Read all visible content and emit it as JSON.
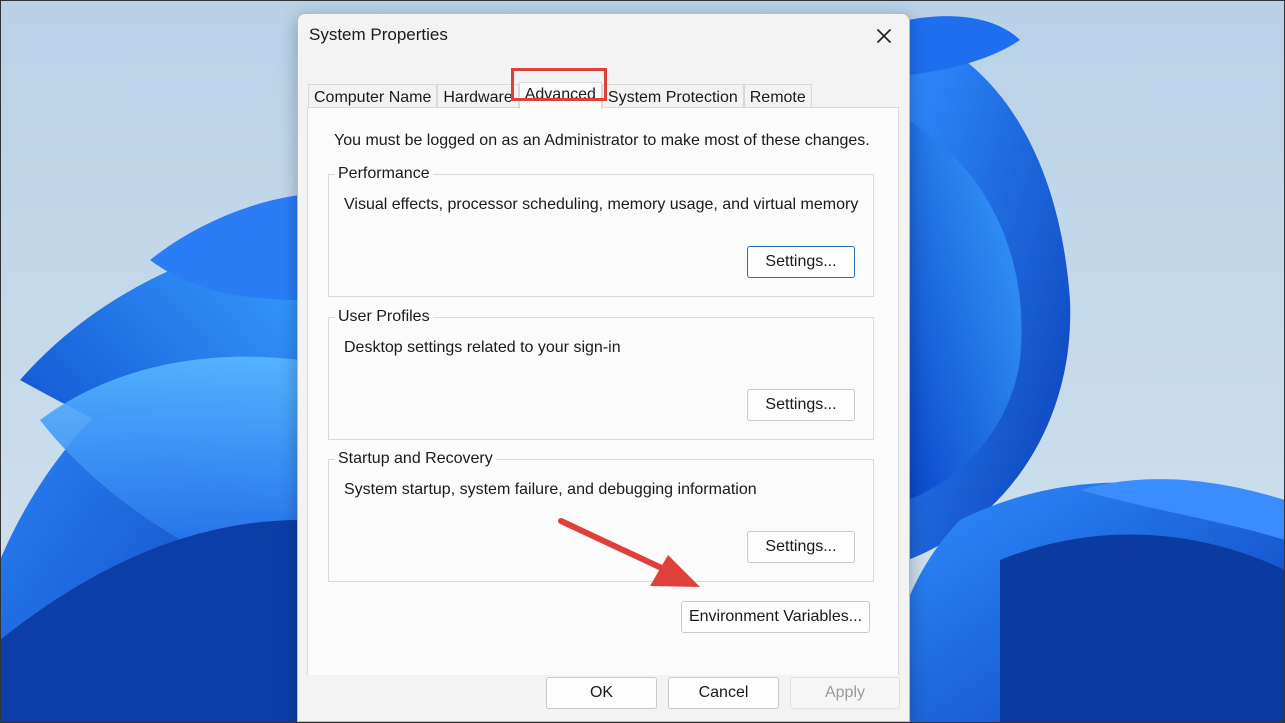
{
  "window": {
    "title": "System Properties",
    "close_icon": "close-icon"
  },
  "tabs": [
    {
      "label": "Computer Name",
      "active": false
    },
    {
      "label": "Hardware",
      "active": false
    },
    {
      "label": "Advanced",
      "active": true
    },
    {
      "label": "System Protection",
      "active": false
    },
    {
      "label": "Remote",
      "active": false
    }
  ],
  "advanced": {
    "admin_note": "You must be logged on as an Administrator to make most of these changes.",
    "performance": {
      "label": "Performance",
      "description": "Visual effects, processor scheduling, memory usage, and virtual memory",
      "button": "Settings..."
    },
    "user_profiles": {
      "label": "User Profiles",
      "description": "Desktop settings related to your sign-in",
      "button": "Settings..."
    },
    "startup_recovery": {
      "label": "Startup and Recovery",
      "description": "System startup, system failure, and debugging information",
      "button": "Settings..."
    },
    "environment_variables_button": "Environment Variables..."
  },
  "footer": {
    "ok": "OK",
    "cancel": "Cancel",
    "apply": "Apply"
  },
  "colors": {
    "annotation_red": "#e0403a",
    "wallpaper_blue": "#1565e0",
    "focus_border": "#2b6cb0"
  }
}
